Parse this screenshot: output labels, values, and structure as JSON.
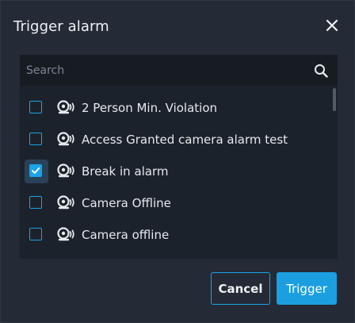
{
  "dialog": {
    "title": "Trigger alarm",
    "close_icon": "close-icon"
  },
  "search": {
    "placeholder": "Search",
    "value": "",
    "icon": "search-icon"
  },
  "alarms": [
    {
      "label": "2 Person Min. Violation",
      "checked": false
    },
    {
      "label": "Access Granted camera alarm test",
      "checked": false
    },
    {
      "label": "Break in alarm",
      "checked": true
    },
    {
      "label": "Camera Offline",
      "checked": false
    },
    {
      "label": "Camera offline",
      "checked": false
    }
  ],
  "buttons": {
    "cancel": "Cancel",
    "trigger": "Trigger"
  },
  "colors": {
    "accent": "#1aa3e8",
    "dialog_bg": "#242b36",
    "list_bg": "#1c222b"
  }
}
